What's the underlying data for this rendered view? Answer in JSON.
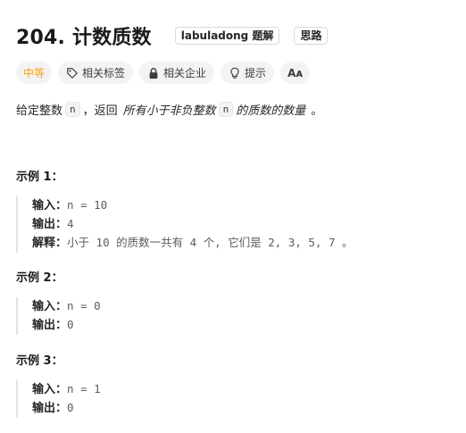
{
  "problem": {
    "title": "204. 计数质数",
    "tag_labuladong": "labuladong 题解",
    "tag_hint": "思路"
  },
  "pills": {
    "difficulty": "中等",
    "related_tags": "相关标签",
    "related_companies": "相关企业",
    "hint": "提示",
    "lang": "Aᴀ"
  },
  "description": {
    "prefix": "给定整数",
    "var_n": "n",
    "middle": "，返回",
    "italic": "所有小于非负整数",
    "var_n2": "n",
    "suffix_em": "的质数的数量",
    "end": "。"
  },
  "examples": [
    {
      "title": "示例 1：",
      "input_label": "输入：",
      "input_value": "n = 10",
      "output_label": "输出：",
      "output_value": "4",
      "explain_label": "解释：",
      "explain_value": "小于 10 的质数一共有 4 个, 它们是 2, 3, 5, 7 。"
    },
    {
      "title": "示例 2：",
      "input_label": "输入：",
      "input_value": "n = 0",
      "output_label": "输出：",
      "output_value": "0"
    },
    {
      "title": "示例 3：",
      "input_label": "输入：",
      "input_value": "n = 1",
      "output_label": "输出：",
      "output_value": "0"
    }
  ]
}
